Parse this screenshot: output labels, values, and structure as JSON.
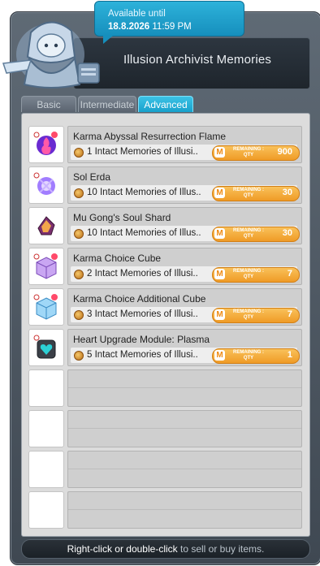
{
  "tooltip": {
    "line1": "Available until",
    "date": "18.8.2026",
    "time": "11:59 PM"
  },
  "header": {
    "title": "Illusion Archivist Memories"
  },
  "tabs": [
    {
      "label": "Basic",
      "active": false
    },
    {
      "label": "Intermediate",
      "active": false
    },
    {
      "label": "Advanced",
      "active": true
    }
  ],
  "items": [
    {
      "name": "Karma Abyssal Resurrection Flame",
      "cost": "1 Intact Memories of Illusi..",
      "remaining_label_1": "REMAINING :",
      "remaining_label_2": "QTY",
      "remaining": "900",
      "icon": "karma-flame-icon"
    },
    {
      "name": "Sol Erda",
      "cost": "10 Intact Memories of Illus..",
      "remaining_label_1": "REMAINING :",
      "remaining_label_2": "QTY",
      "remaining": "30",
      "icon": "sol-erda-icon"
    },
    {
      "name": "Mu Gong's Soul Shard",
      "cost": "10 Intact Memories of Illus..",
      "remaining_label_1": "REMAINING :",
      "remaining_label_2": "QTY",
      "remaining": "30",
      "icon": "soul-shard-icon"
    },
    {
      "name": "Karma Choice Cube",
      "cost": "2 Intact Memories of Illusi..",
      "remaining_label_1": "REMAINING :",
      "remaining_label_2": "QTY",
      "remaining": "7",
      "icon": "choice-cube-icon"
    },
    {
      "name": "Karma Choice Additional Cube",
      "cost": "3 Intact Memories of Illusi..",
      "remaining_label_1": "REMAINING :",
      "remaining_label_2": "QTY",
      "remaining": "7",
      "icon": "additional-cube-icon"
    },
    {
      "name": "Heart Upgrade Module: Plasma",
      "cost": "5 Intact Memories of Illusi..",
      "remaining_label_1": "REMAINING :",
      "remaining_label_2": "QTY",
      "remaining": "1",
      "icon": "heart-module-icon"
    }
  ],
  "empty_slots": 4,
  "footer": {
    "part1": "Right-click or double-click",
    "part2": " to sell or buy items."
  },
  "colors": {
    "accent": "#18a1cc",
    "remaining_badge": "#ef9b26"
  }
}
